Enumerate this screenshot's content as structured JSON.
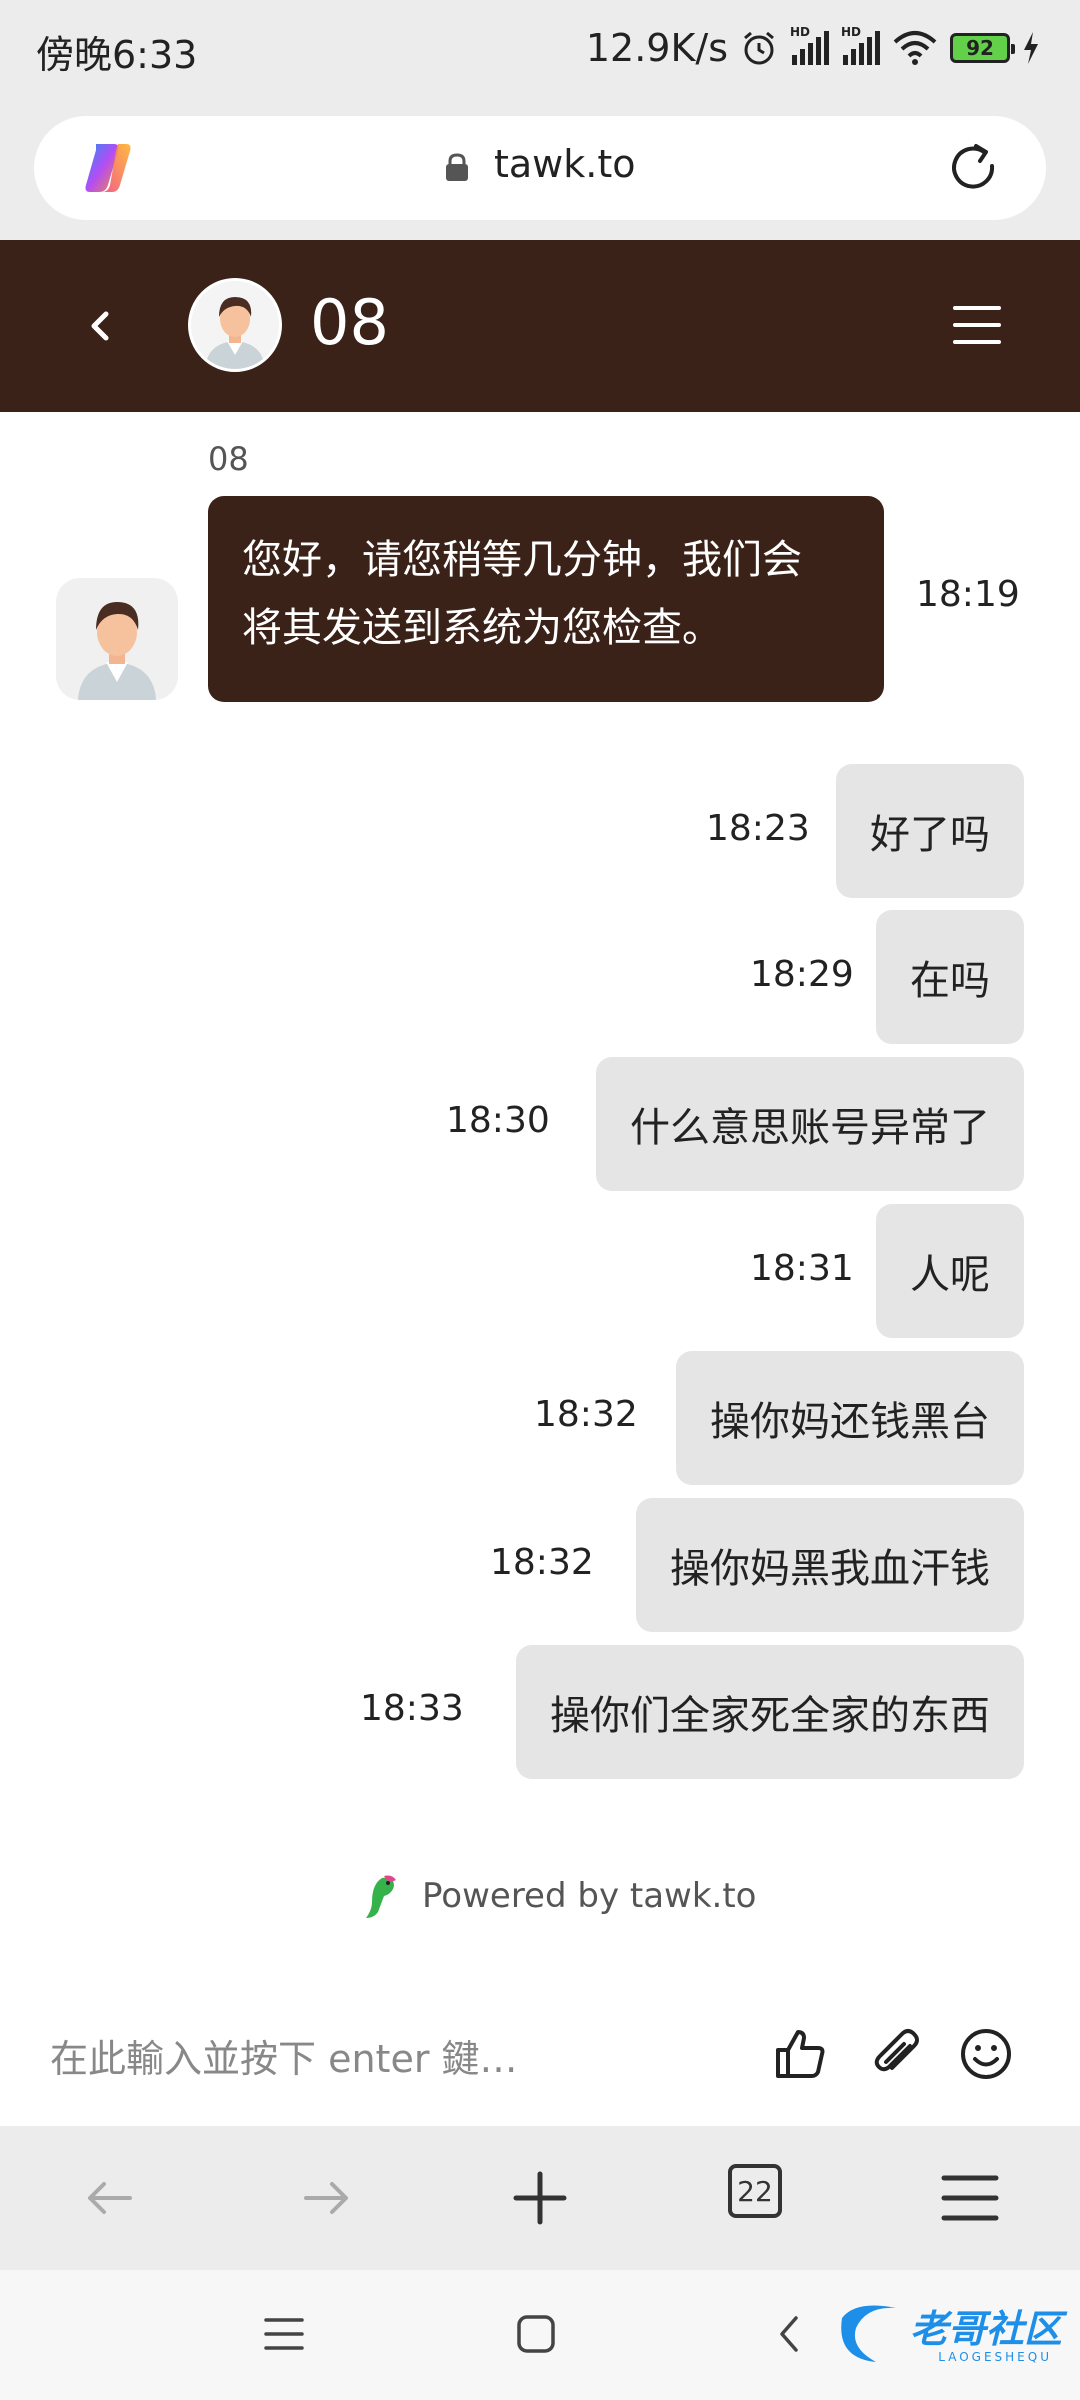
{
  "status_bar": {
    "time": "傍晚6:33",
    "network_speed": "12.9K/s",
    "battery_level": "92",
    "icons": [
      "alarm-icon",
      "signal-hd-icon",
      "signal-hd-icon",
      "wifi-icon",
      "battery-icon",
      "charging-icon"
    ]
  },
  "browser": {
    "url": "tawk.to",
    "tab_count": "22"
  },
  "chat_header": {
    "agent_name": "08"
  },
  "messages": {
    "agent": {
      "sender": "08",
      "text_line1": "您好，请您稍等几分钟，我们会",
      "text_line2": "将其发送到系统为您检查。",
      "time": "18:19"
    },
    "user": [
      {
        "text": "好了吗",
        "time": "18:23"
      },
      {
        "text": "在吗",
        "time": "18:29"
      },
      {
        "text": "什么意思账号异常了",
        "time": "18:30"
      },
      {
        "text": "人呢",
        "time": "18:31"
      },
      {
        "text": "操你妈还钱黑台",
        "time": "18:32"
      },
      {
        "text": "操你妈黑我血汗钱",
        "time": "18:32"
      },
      {
        "text": "操你们全家死全家的东西",
        "time": "18:33"
      }
    ]
  },
  "footer": {
    "powered_by": "Powered by tawk.to"
  },
  "input": {
    "placeholder": "在此輸入並按下 enter 鍵…"
  },
  "watermark": {
    "text": "老哥社区",
    "subtext": "LAOGESHEQU"
  },
  "colors": {
    "brand": "#3b2218",
    "user_bubble": "#e5e5e5",
    "chrome": "#ececec"
  }
}
